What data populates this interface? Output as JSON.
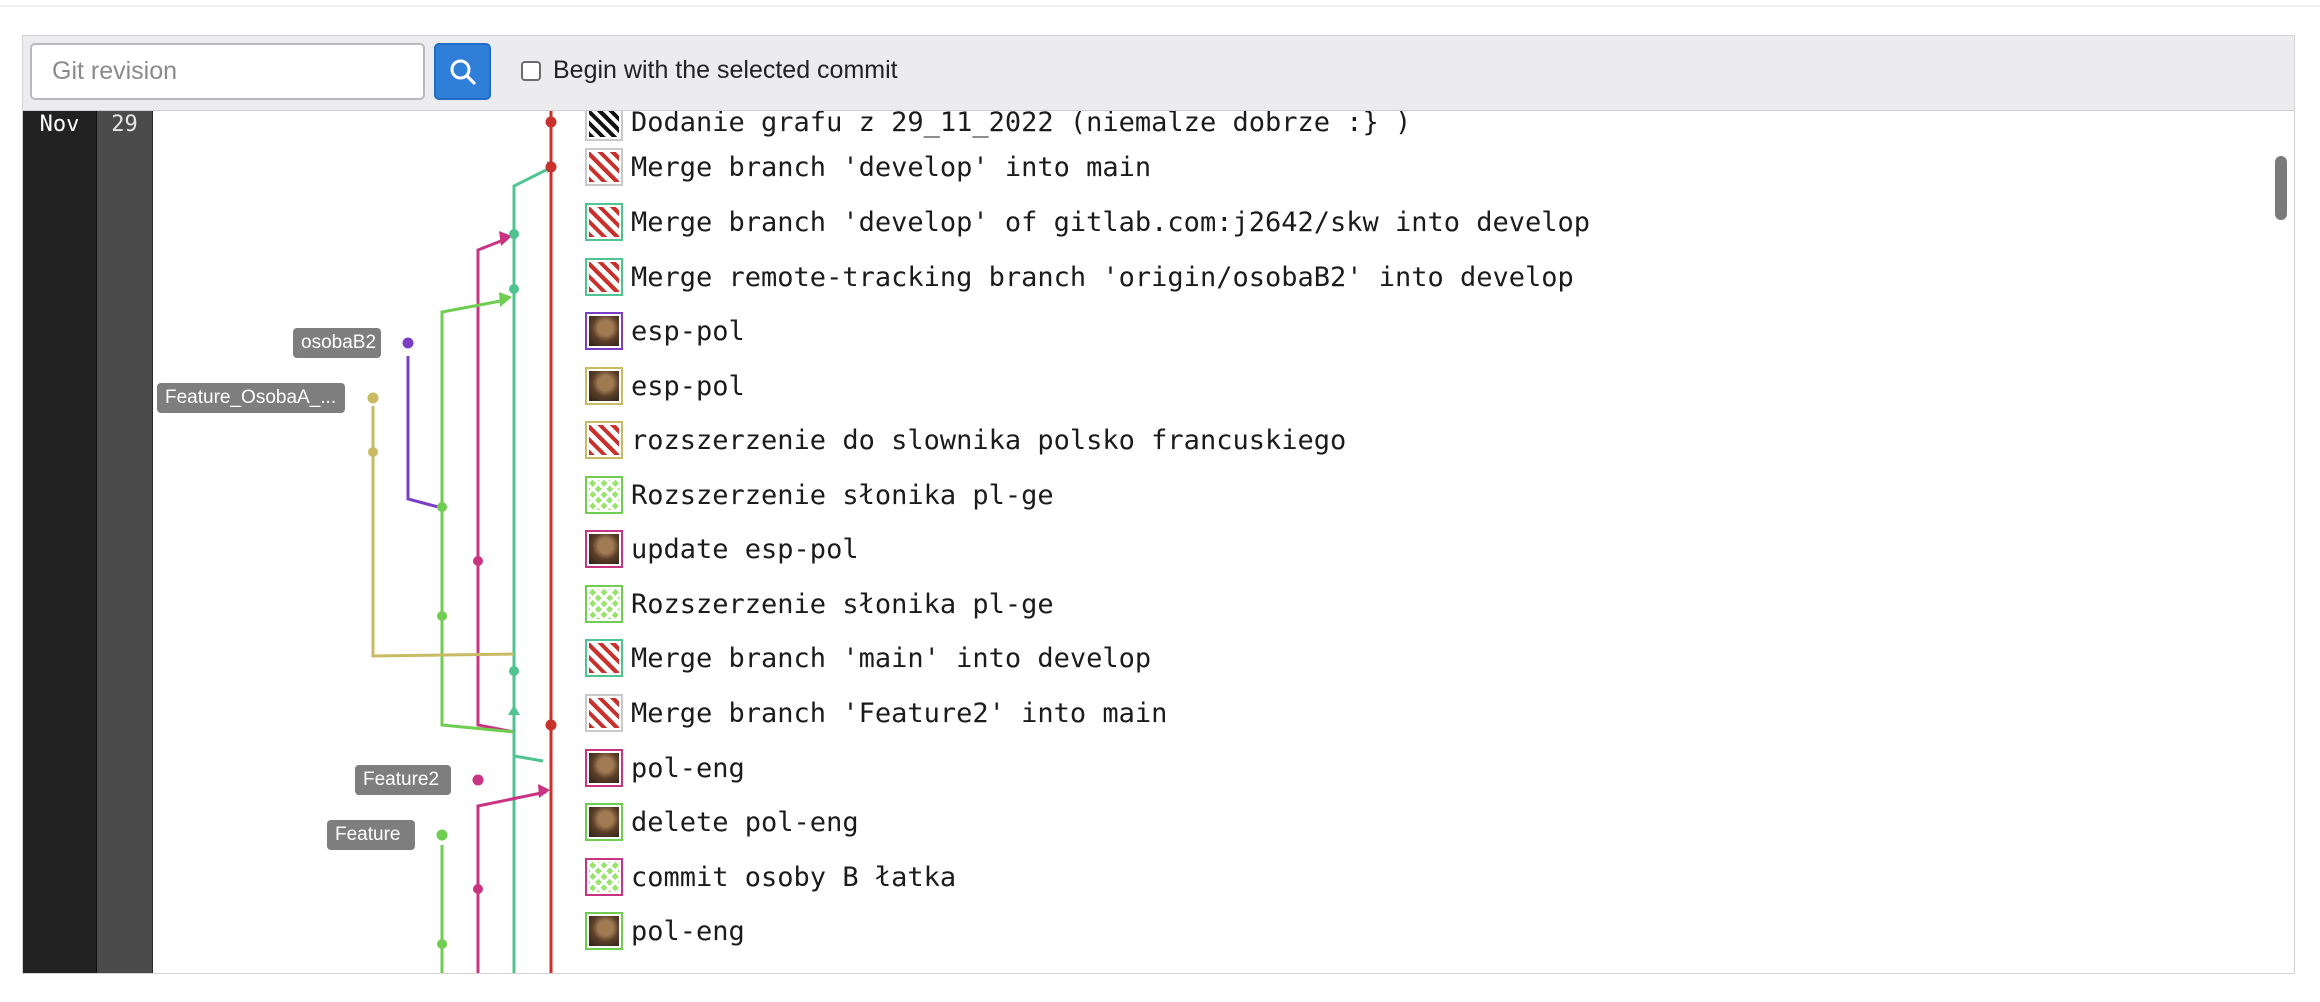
{
  "toolbar": {
    "revision_placeholder": "Git revision",
    "search_icon": "search-icon",
    "checkbox_label": "Begin with the selected commit",
    "checkbox_checked": false
  },
  "dates": {
    "month": "Nov",
    "day": "29"
  },
  "branches": {
    "osobaB2": "osobaB2",
    "feature_osobaA": "Feature_OsobaA_...",
    "feature2": "Feature2",
    "feature": "Feature"
  },
  "colors": {
    "main_red": "#c8312c",
    "teal": "#4fc491",
    "magenta": "#c83482",
    "green": "#6fcd51",
    "purple": "#7a3fc4",
    "olive": "#c9bb63",
    "search_button": "#2f7fd8"
  },
  "commits": [
    {
      "message": "Dodanie grafu z 29_11_2022 (niemalze dobrze :} )",
      "avatar": "pixel-black"
    },
    {
      "message": "Merge branch 'develop' into main",
      "avatar": "quilt-red"
    },
    {
      "message": "Merge branch 'develop' of gitlab.com:j2642/skw into develop",
      "avatar": "quilt-red"
    },
    {
      "message": "Merge remote-tracking branch 'origin/osobaB2' into develop",
      "avatar": "quilt-red"
    },
    {
      "message": "esp-pol",
      "avatar": "photo-purple"
    },
    {
      "message": "esp-pol",
      "avatar": "photo-olive"
    },
    {
      "message": "rozszerzenie do slownika polsko francuskiego",
      "avatar": "quilt-red"
    },
    {
      "message": "Rozszerzenie słonika pl-ge",
      "avatar": "quilt-green"
    },
    {
      "message": "update esp-pol",
      "avatar": "photo-magenta"
    },
    {
      "message": "Rozszerzenie słonika pl-ge",
      "avatar": "quilt-green"
    },
    {
      "message": "Merge branch 'main' into develop",
      "avatar": "quilt-red"
    },
    {
      "message": "Merge branch 'Feature2' into main",
      "avatar": "quilt-red"
    },
    {
      "message": "pol-eng",
      "avatar": "photo-magenta"
    },
    {
      "message": "delete pol-eng",
      "avatar": "photo-green"
    },
    {
      "message": "commit osoby B łatka",
      "avatar": "quilt-green"
    },
    {
      "message": "pol-eng",
      "avatar": "photo-green"
    }
  ]
}
